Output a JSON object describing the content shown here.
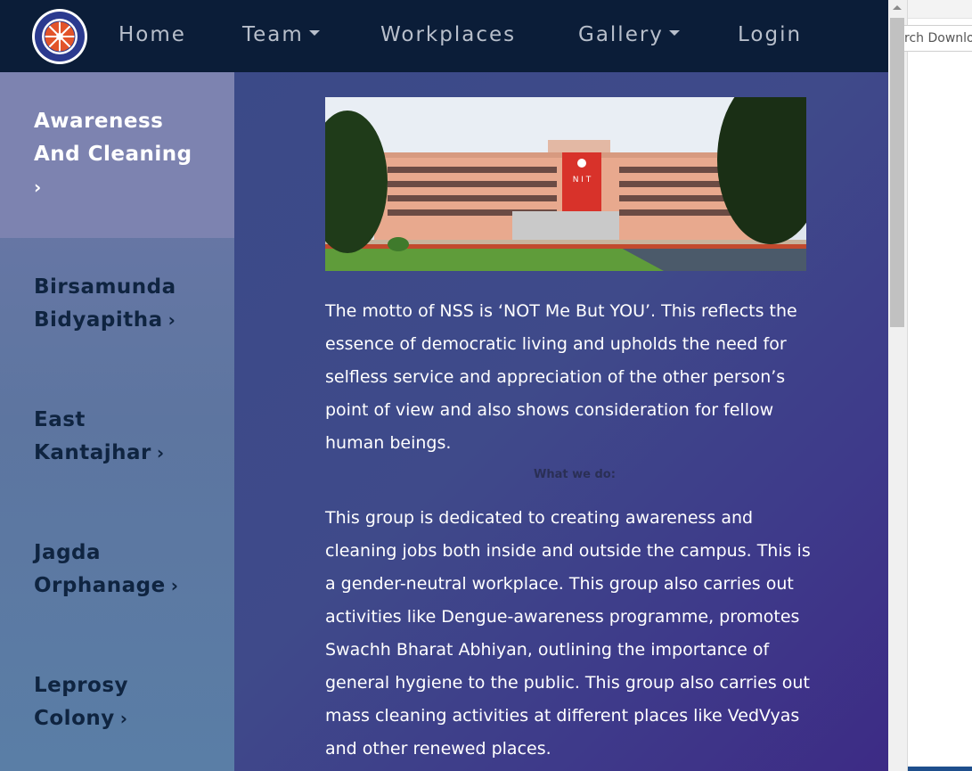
{
  "navbar": {
    "logo_icon": "nss-emblem-icon",
    "items": [
      {
        "label": "Home",
        "has_dropdown": false
      },
      {
        "label": "Team",
        "has_dropdown": true
      },
      {
        "label": "Workplaces",
        "has_dropdown": false
      },
      {
        "label": "Gallery",
        "has_dropdown": true
      },
      {
        "label": "Login",
        "has_dropdown": false
      }
    ]
  },
  "sidebar": {
    "items": [
      {
        "line1": "Awareness",
        "line2": "And Cleaning",
        "line3": "",
        "active": true
      },
      {
        "line1": "Birsamunda",
        "line2": "Bidyapitha",
        "active": false
      },
      {
        "line1": "East",
        "line2": "Kantajhar",
        "active": false
      },
      {
        "line1": "Jagda",
        "line2": "Orphanage",
        "active": false
      },
      {
        "line1": "Leprosy",
        "line2": "Colony",
        "active": false
      }
    ],
    "chevron_icon": "chevron-right-icon"
  },
  "main": {
    "image_text": "N I T",
    "motto_paragraph": "The motto of NSS is ‘NOT Me But YOU’. This reflects the essence of democratic living and upholds the need for selfless service and appreciation of the other person’s point of view and also shows consideration for fellow human beings.",
    "what_heading": "What we do:",
    "description_paragraph": "This group is dedicated to creating awareness and cleaning jobs both inside and outside the campus. This is a gender-neutral workplace. This group also carries out activities like Dengue-awareness programme, promotes Swachh Bharat Abhiyan, outlining the importance of general hygiene to the public. This group also carries out mass cleaning activities at different places like VedVyas and other renewed places."
  },
  "right_pane": {
    "search_partial": "rch Downlo"
  },
  "colors": {
    "navbar_bg": "#0b1d38",
    "nav_text": "#b8bfcb",
    "active_sidebar_bg": "#7d83b0",
    "sidebar_text": "#0f2440",
    "main_gradient_start": "#3b4a88",
    "main_gradient_end": "#3d2b85"
  }
}
